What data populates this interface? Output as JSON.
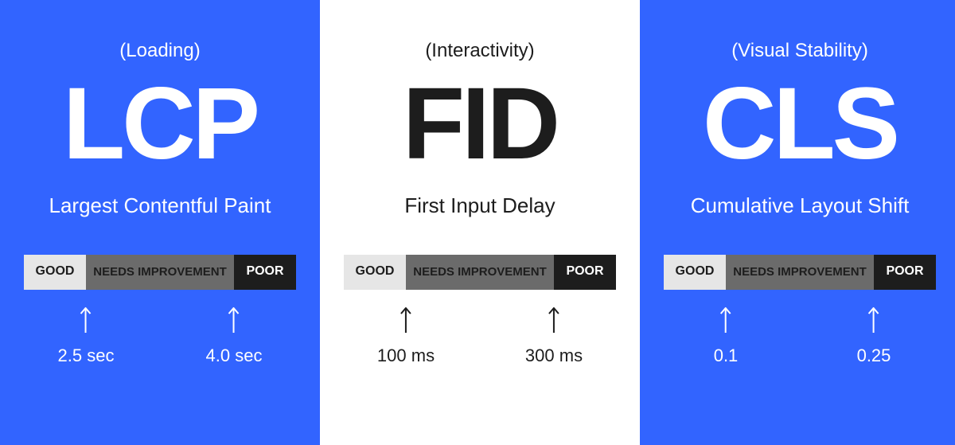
{
  "scale_labels": {
    "good": "GOOD",
    "needs": "NEEDS IMPROVEMENT",
    "poor": "POOR"
  },
  "metrics": [
    {
      "category": "(Loading)",
      "acronym": "LCP",
      "fullname": "Largest Contentful Paint",
      "threshold_good": "2.5 sec",
      "threshold_poor": "4.0 sec",
      "variant": "blue"
    },
    {
      "category": "(Interactivity)",
      "acronym": "FID",
      "fullname": "First Input Delay",
      "threshold_good": "100 ms",
      "threshold_poor": "300 ms",
      "variant": "white"
    },
    {
      "category": "(Visual Stability)",
      "acronym": "CLS",
      "fullname": "Cumulative Layout Shift",
      "threshold_good": "0.1",
      "threshold_poor": "0.25",
      "variant": "blue"
    }
  ]
}
